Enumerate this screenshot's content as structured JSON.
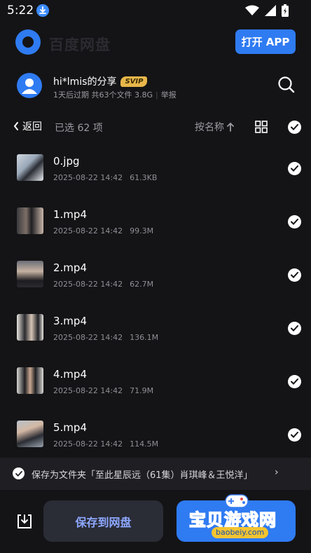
{
  "status_bar": {
    "time": "5:22"
  },
  "header": {
    "open_app_label": "打开 APP",
    "brand_text": "百度网盘"
  },
  "share": {
    "title": "hi*lmis的分享",
    "badge": "SVIP",
    "expiry": "1天后过期",
    "summary": "共63个文件 3.8G",
    "report_label": "举报"
  },
  "toolbar": {
    "back_label": "返回",
    "selected_text": "已选 62 项",
    "sort_label": "按名称"
  },
  "files": [
    {
      "name": "0.jpg",
      "date": "2025-08-22 14:42",
      "size": "61.3KB"
    },
    {
      "name": "1.mp4",
      "date": "2025-08-22 14:42",
      "size": "99.3M"
    },
    {
      "name": "2.mp4",
      "date": "2025-08-22 14:42",
      "size": "62.7M"
    },
    {
      "name": "3.mp4",
      "date": "2025-08-22 14:42",
      "size": "136.1M"
    },
    {
      "name": "4.mp4",
      "date": "2025-08-22 14:42",
      "size": "71.9M"
    },
    {
      "name": "5.mp4",
      "date": "2025-08-22 14:42",
      "size": "114.5M"
    }
  ],
  "save_folder": {
    "text": "保存为文件夹「至此星辰远（61集）肖琪峰＆王悦洋」",
    "chevron": "›"
  },
  "bottom": {
    "save_button_label": "保存到网盘",
    "watermark_text": "宝贝游戏网",
    "watermark_url": "baobeiy.com"
  },
  "colors": {
    "accent": "#2f7bf2",
    "background": "#141416",
    "svip": "#e8b64a"
  }
}
